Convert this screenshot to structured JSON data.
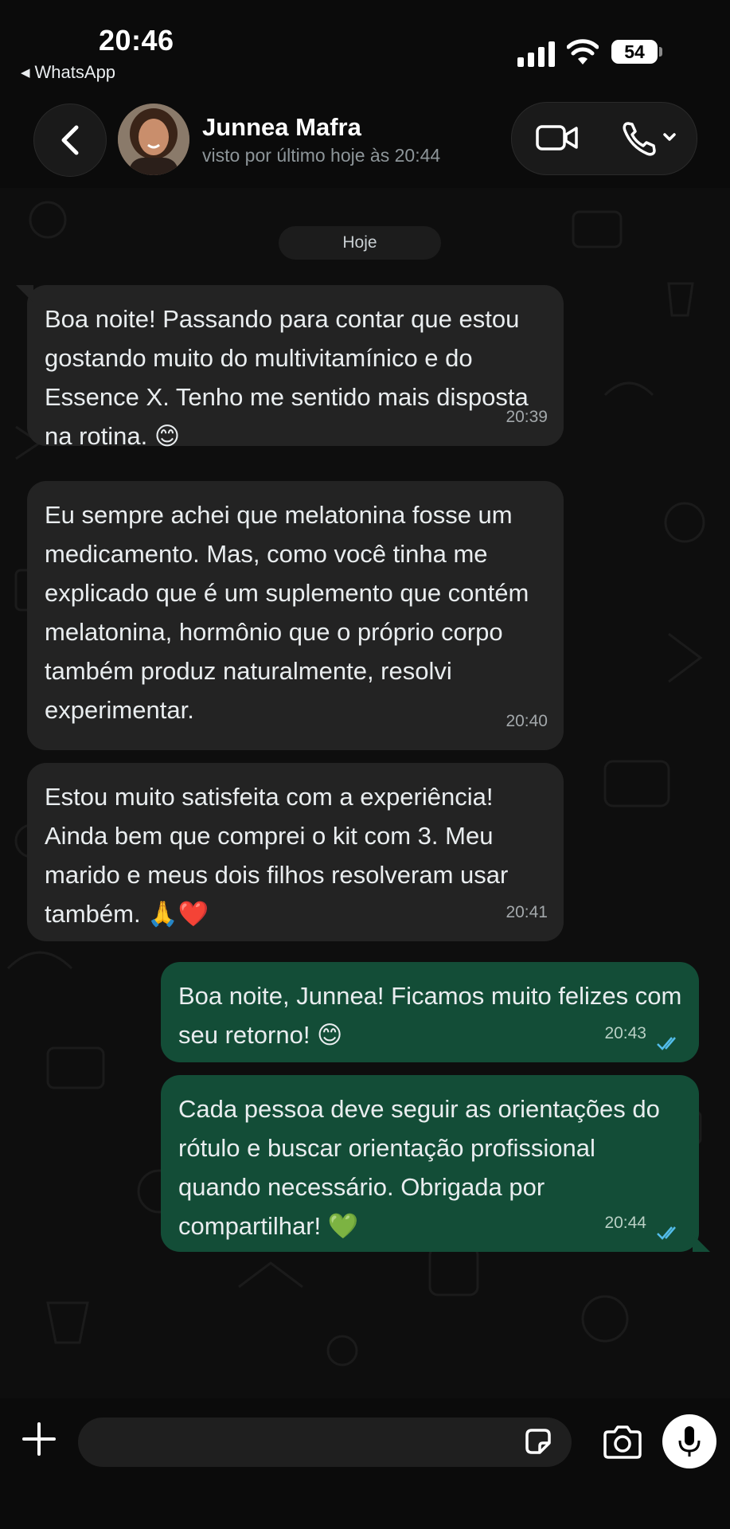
{
  "status_bar": {
    "time": "20:46",
    "back_app": "WhatsApp",
    "battery": "54"
  },
  "header": {
    "contact_name": "Junnea Mafra",
    "last_seen": "visto por último hoje às 20:44"
  },
  "chat": {
    "date_chip": "Hoje",
    "messages": [
      {
        "direction": "incoming",
        "text": "Boa noite! Passando para contar que estou gostando muito do multivitamínico e do Essence X. Tenho me sentido mais disposta na rotina. 😊",
        "time": "20:39"
      },
      {
        "direction": "incoming",
        "text": "Eu sempre achei que melatonina fosse um medicamento. Mas, como você tinha me explicado que é um suplemento que contém melatonina, hormônio que o próprio corpo também produz naturalmente, resolvi experimentar.",
        "time": "20:40"
      },
      {
        "direction": "incoming",
        "text": "Estou muito satisfeita com a experiência! Ainda bem que comprei o kit com 3. Meu marido e meus dois filhos resolveram usar também. 🙏❤️",
        "time": "20:41"
      },
      {
        "direction": "outgoing",
        "text": "Boa noite, Junnea! Ficamos muito felizes com seu retorno! 😊",
        "time": "20:43",
        "status": "read"
      },
      {
        "direction": "outgoing",
        "text": "Cada pessoa deve seguir as orientações do rótulo e buscar orientação profissional quando necessário. Obrigada por compartilhar! 💚",
        "time": "20:44",
        "status": "read"
      }
    ]
  },
  "composer": {
    "value": ""
  },
  "colors": {
    "background": "#0e0e0e",
    "incoming_bubble": "#232323",
    "outgoing_bubble": "#134d37",
    "read_ticks": "#53bdeb"
  },
  "icons": [
    "back-chevron-icon",
    "video-call-icon",
    "voice-call-icon",
    "plus-icon",
    "sticker-icon",
    "camera-icon",
    "microphone-icon"
  ]
}
